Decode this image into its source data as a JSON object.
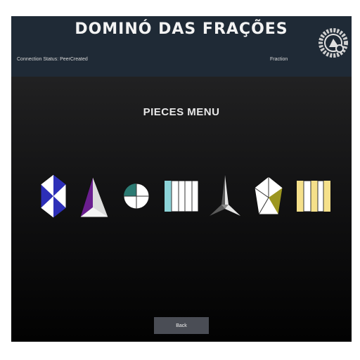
{
  "header": {
    "title": "DOMINÓ DAS FRAÇÕES",
    "connection_status": "Connection Status: PeerCreated",
    "player_name": "Fraction",
    "logo_icon": "gear-logo-icon"
  },
  "menu": {
    "title": "PIECES MENU",
    "pieces": [
      {
        "shape": "hexagon",
        "icon": "hexagon-piece-icon",
        "colors": [
          "#2d2fb8",
          "#ffffff"
        ]
      },
      {
        "shape": "triangle",
        "icon": "triangle-piece-icon",
        "colors": [
          "#6a1e8f",
          "#ffffff"
        ]
      },
      {
        "shape": "circle",
        "icon": "circle-piece-icon",
        "colors": [
          "#2b7a72",
          "#ffffff"
        ]
      },
      {
        "shape": "rectangle",
        "icon": "rectangle-piece-icon",
        "colors": [
          "#8cd3d8",
          "#ffffff"
        ]
      },
      {
        "shape": "arrow-star",
        "icon": "arrow-star-piece-icon",
        "colors": [
          "#5a5a5a",
          "#ffffff"
        ]
      },
      {
        "shape": "pentagon",
        "icon": "pentagon-piece-icon",
        "colors": [
          "#9c9620",
          "#ffffff"
        ]
      },
      {
        "shape": "rectangle",
        "icon": "yellow-rectangle-piece-icon",
        "colors": [
          "#f5e08a",
          "#ffffff"
        ]
      }
    ]
  },
  "back_label": "Back"
}
